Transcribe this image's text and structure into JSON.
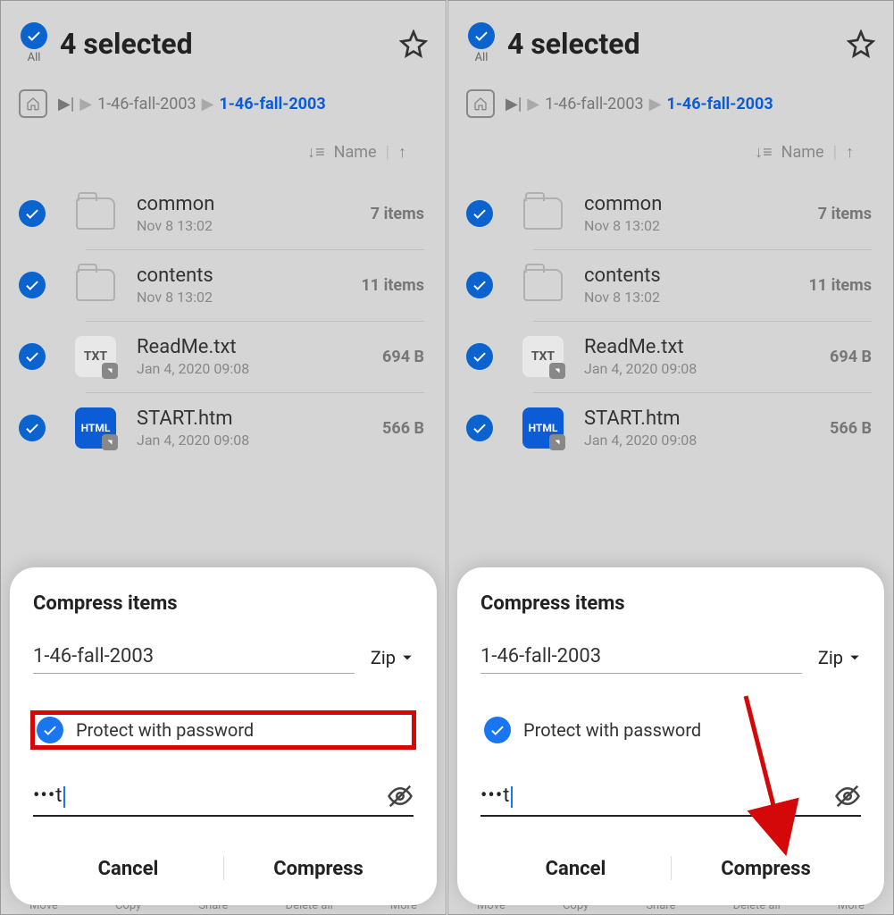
{
  "header": {
    "all_label": "All",
    "title": "4 selected"
  },
  "breadcrumb": {
    "parent": "1-46-fall-2003",
    "current": "1-46-fall-2003"
  },
  "sort": {
    "label": "Name"
  },
  "files": [
    {
      "name": "common",
      "meta": "Nov 8 13:02",
      "size": "7 items",
      "kind": "folder"
    },
    {
      "name": "contents",
      "meta": "Nov 8 13:02",
      "size": "11 items",
      "kind": "folder"
    },
    {
      "name": "ReadMe.txt",
      "meta": "Jan 4, 2020 09:08",
      "size": "694 B",
      "kind": "txt",
      "badge": "TXT"
    },
    {
      "name": "START.htm",
      "meta": "Jan 4, 2020 09:08",
      "size": "566 B",
      "kind": "html",
      "badge": "HTML"
    }
  ],
  "sheet": {
    "title": "Compress items",
    "archive_name": "1-46-fall-2003",
    "format": "Zip",
    "protect_label": "Protect with password",
    "password_masked": "•••t",
    "cancel": "Cancel",
    "compress": "Compress"
  },
  "bottombar": {
    "move": "Move",
    "copy": "Copy",
    "share": "Share",
    "delete_all": "Delete all",
    "more": "More"
  }
}
